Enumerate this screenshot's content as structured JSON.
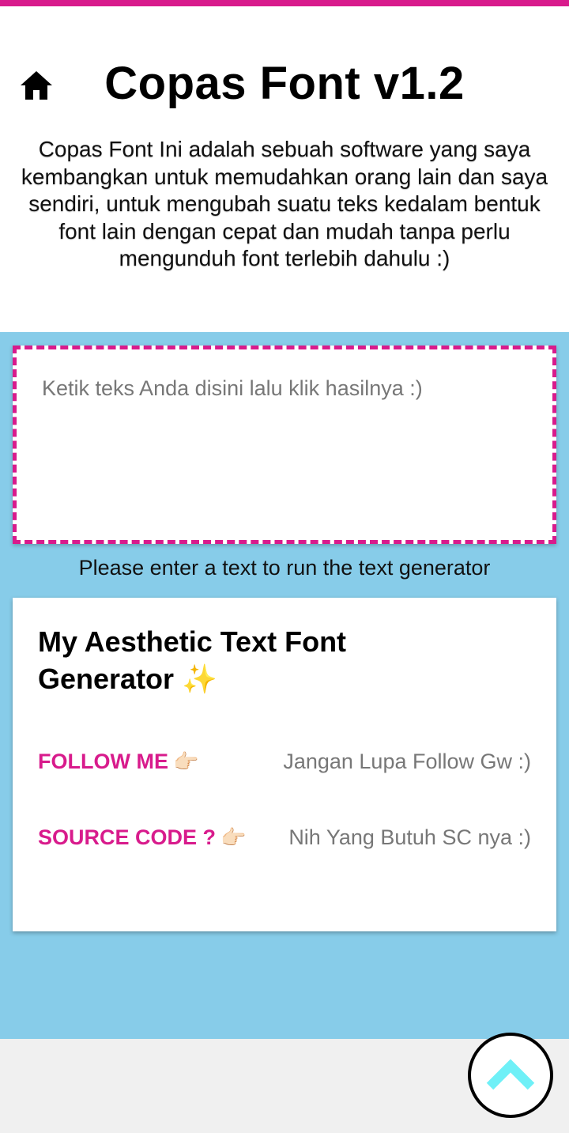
{
  "header": {
    "title": "Copas Font v1.2",
    "description": "Copas Font Ini adalah sebuah software yang saya kembangkan untuk memudahkan orang lain dan saya sendiri, untuk mengubah suatu teks kedalam bentuk font lain dengan cepat dan mudah tanpa perlu mengunduh font terlebih dahulu :)",
    "home_icon": "home-icon"
  },
  "input": {
    "placeholder": "Ketik teks Anda disini lalu klik hasilnya :)",
    "value": ""
  },
  "status": {
    "message": "Please enter a text to run the text generator"
  },
  "card": {
    "title": "My Aesthetic Text Font Generator",
    "title_emoji": "✨",
    "rows": [
      {
        "label": "FOLLOW ME",
        "hand": "👉🏻",
        "value": "Jangan Lupa Follow Gw :)"
      },
      {
        "label": "SOURCE CODE ?",
        "hand": "👉🏻",
        "value": "Nih Yang Butuh SC nya :)"
      }
    ]
  },
  "scroll_top": {
    "icon": "chevron-up-icon"
  },
  "colors": {
    "accent": "#d81b8c",
    "background_blue": "#87cce9",
    "chevron": "#6ff0f7"
  }
}
